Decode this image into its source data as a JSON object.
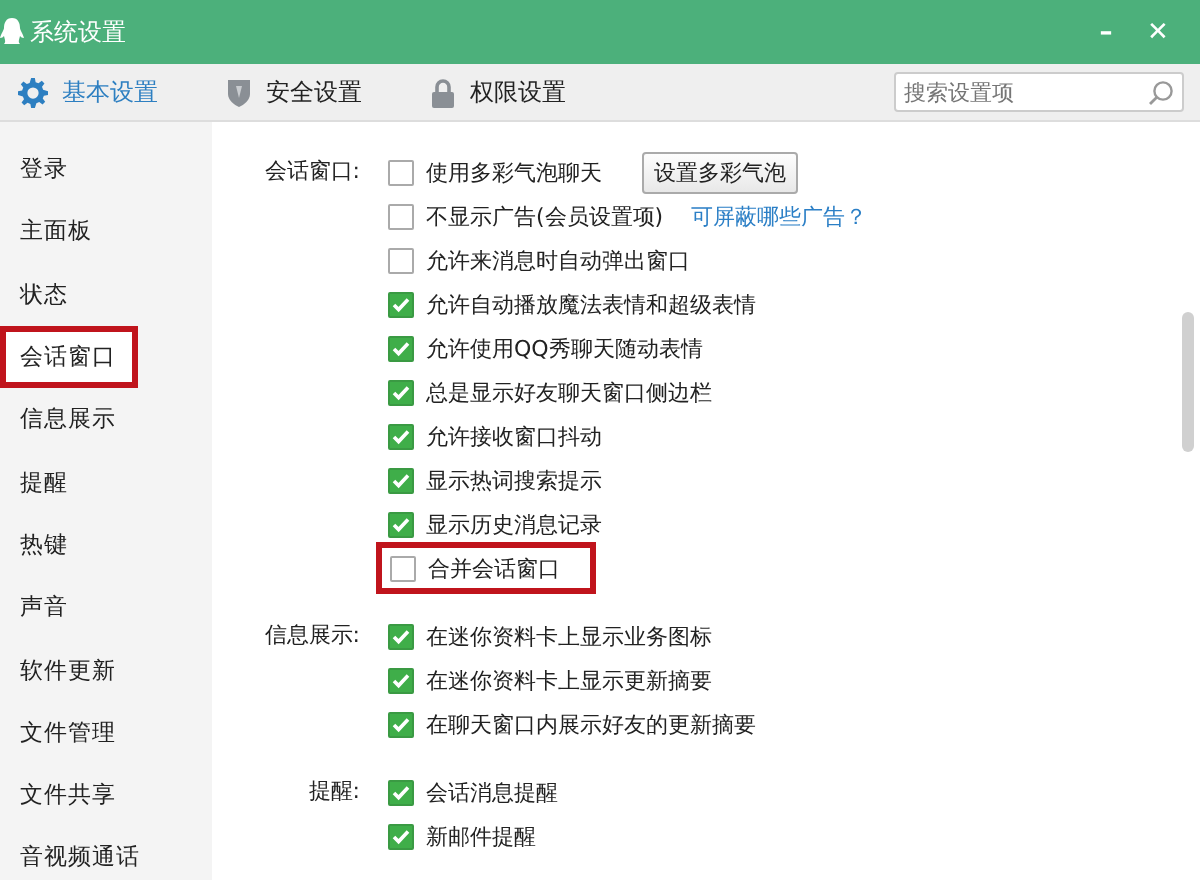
{
  "window": {
    "title": "系统设置",
    "controls": [
      "–",
      "✕"
    ]
  },
  "tabs": [
    {
      "label": "基本设置",
      "selected": true
    },
    {
      "label": "安全设置",
      "selected": false
    },
    {
      "label": "权限设置",
      "selected": false
    }
  ],
  "search": {
    "placeholder": "搜索设置项"
  },
  "sidebar": {
    "items": [
      {
        "label": "登录",
        "selected": false
      },
      {
        "label": "主面板",
        "selected": false
      },
      {
        "label": "状态",
        "selected": false
      },
      {
        "label": "会话窗口",
        "selected": true
      },
      {
        "label": "信息展示",
        "selected": false
      },
      {
        "label": "提醒",
        "selected": false
      },
      {
        "label": "热键",
        "selected": false
      },
      {
        "label": "声音",
        "selected": false
      },
      {
        "label": "软件更新",
        "selected": false
      },
      {
        "label": "文件管理",
        "selected": false
      },
      {
        "label": "文件共享",
        "selected": false
      },
      {
        "label": "音视频通话",
        "selected": false
      }
    ]
  },
  "sections": [
    {
      "label": "会话窗口:",
      "options": [
        {
          "label": "使用多彩气泡聊天",
          "checked": false,
          "highlighted": false,
          "button": "设置多彩气泡"
        },
        {
          "label": "不显示广告(会员设置项)",
          "checked": false,
          "highlighted": false,
          "link": "可屏蔽哪些广告？"
        },
        {
          "label": "允许来消息时自动弹出窗口",
          "checked": false,
          "highlighted": false
        },
        {
          "label": "允许自动播放魔法表情和超级表情",
          "checked": true,
          "highlighted": false
        },
        {
          "label": "允许使用QQ秀聊天随动表情",
          "checked": true,
          "highlighted": false
        },
        {
          "label": "总是显示好友聊天窗口侧边栏",
          "checked": true,
          "highlighted": false
        },
        {
          "label": "允许接收窗口抖动",
          "checked": true,
          "highlighted": false
        },
        {
          "label": "显示热词搜索提示",
          "checked": true,
          "highlighted": false
        },
        {
          "label": "显示历史消息记录",
          "checked": true,
          "highlighted": false
        },
        {
          "label": "合并会话窗口",
          "checked": false,
          "highlighted": true
        }
      ]
    },
    {
      "label": "信息展示:",
      "options": [
        {
          "label": "在迷你资料卡上显示业务图标",
          "checked": true,
          "highlighted": false
        },
        {
          "label": "在迷你资料卡上显示更新摘要",
          "checked": true,
          "highlighted": false
        },
        {
          "label": "在聊天窗口内展示好友的更新摘要",
          "checked": true,
          "highlighted": false
        }
      ]
    },
    {
      "label": "提醒:",
      "options": [
        {
          "label": "会话消息提醒",
          "checked": true,
          "highlighted": false
        },
        {
          "label": "新邮件提醒",
          "checked": true,
          "highlighted": false
        }
      ]
    }
  ]
}
